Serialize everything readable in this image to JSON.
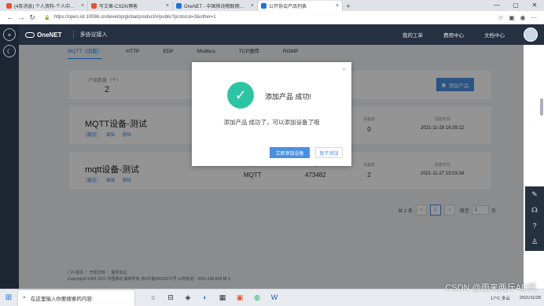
{
  "browser": {
    "tabs": [
      {
        "title": "(4条消息) 个人资料-个人中心-C",
        "icon": "csdn-icon",
        "color": "#e8542f"
      },
      {
        "title": "写文章-CSDN博客",
        "icon": "csdn-icon",
        "color": "#e8542f"
      },
      {
        "title": "OneNET - 中国移动物联网开放平",
        "icon": "onenet-icon",
        "color": "#1e73d8"
      },
      {
        "title": "公开协议产品列表",
        "icon": "onenet-icon",
        "color": "#1e73d8"
      }
    ],
    "url": "https://open.iot.10086.cn/develop/global/product/#/public?protocol=3&other=1"
  },
  "header": {
    "brand": "OneNET",
    "subtitle": "多协议接入",
    "links": [
      "我的工单",
      "费用中心",
      "文档中心"
    ]
  },
  "subtabs": [
    "MQTT（旧版）",
    "HTTP",
    "EDP",
    "Modbus",
    "TCP透传",
    "RGMP"
  ],
  "stat": {
    "label": "产品数量（个）",
    "value": "2",
    "add_button": "添加产品"
  },
  "products": [
    {
      "name": "MQTT设备-测试",
      "actions": [
        "概况",
        "编辑",
        "删除"
      ],
      "protocol_label": "",
      "protocol": "",
      "id_label": "",
      "id": "",
      "devices_label": "设备数",
      "devices": "0",
      "created_label": "创建时间",
      "created": "2021-11-28 16:39:22"
    },
    {
      "name": "mqtt设备-测试",
      "actions": [
        "概况",
        "编辑",
        "删除"
      ],
      "protocol_label": "协议",
      "protocol": "MQTT",
      "id_label": "产品ID",
      "id": "473482",
      "devices_label": "设备数",
      "devices": "2",
      "created_label": "创建时间",
      "created": "2021-11-27 15:03:34"
    }
  ],
  "pager": {
    "total": "共 2 条",
    "current": "1",
    "goto_label": "跳至",
    "goto_value": "1",
    "page_unit": "页"
  },
  "footer": {
    "links": "门户首页 ｜ 开发文档 ｜ 服务协议",
    "copyright": "Copyright©1999-2021 中国移动 版权所有 京ICP备05002571号 公司电话：4001-100-868 转 3"
  },
  "modal": {
    "title": "添加产品 成功!",
    "message": "添加产品 成功了，可以添加设备了哦",
    "primary": "立即添加设备",
    "secondary": "暂不添加"
  },
  "taskbar": {
    "search_placeholder": "在这里输入你要搜索的内容",
    "weather": "17°C 多云",
    "date": "2021/11/28"
  },
  "watermark": "CSDN @雨来两斤AD钙",
  "colors": {
    "primary": "#4a90e2",
    "success": "#2ec4a3",
    "header": "#253041"
  }
}
